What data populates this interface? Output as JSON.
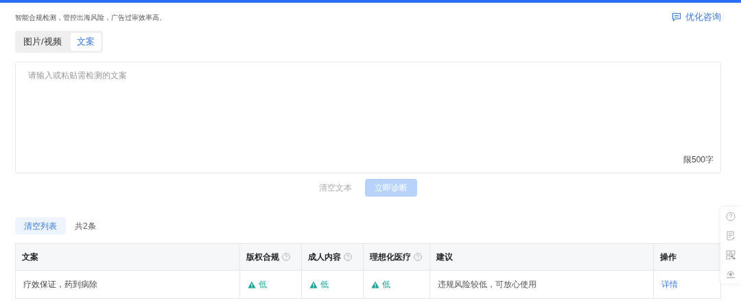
{
  "header": {
    "description": "智能合规检测，管控出海风险，广告过审效率高。",
    "consult_link": "优化咨询"
  },
  "tabs": [
    {
      "label": "图片/视频",
      "selected": false
    },
    {
      "label": "文案",
      "selected": true
    }
  ],
  "text_input": {
    "placeholder": "请输入或粘贴需检测的文案",
    "limit": "限500字"
  },
  "actions": {
    "clear_text": "清空文本",
    "diagnose": {
      "label": "立即诊断",
      "disabled": true
    }
  },
  "list_bar": {
    "clear_list": "清空列表",
    "count": "共2条"
  },
  "table": {
    "columns": [
      {
        "label": "文案",
        "help": false
      },
      {
        "label": "版权合规",
        "help": true
      },
      {
        "label": "成人内容",
        "help": true
      },
      {
        "label": "理想化医疗",
        "help": true
      },
      {
        "label": "建议",
        "help": false
      },
      {
        "label": "操作",
        "help": false
      }
    ],
    "rows": [
      {
        "text": "疗效保证，药到病除",
        "risks": [
          "低",
          "低",
          "低"
        ],
        "advice": "违规风险较低，可放心使用",
        "action": "详情"
      }
    ]
  }
}
